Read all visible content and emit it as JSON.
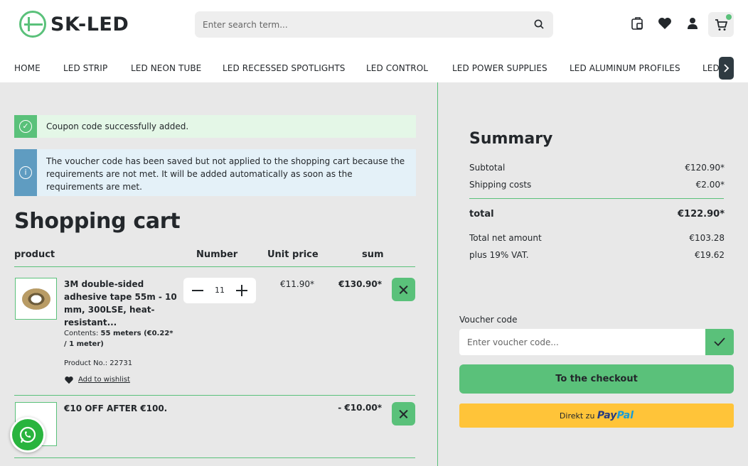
{
  "brand": {
    "name": "SK-LED"
  },
  "search": {
    "placeholder": "Enter search term..."
  },
  "header_icons": [
    "compare-icon",
    "heart-icon",
    "user-icon",
    "cart-icon"
  ],
  "nav": {
    "items": [
      "HOME",
      "LED STRIP",
      "LED NEON TUBE",
      "LED RECESSED SPOTLIGHTS",
      "LED CONTROL",
      "LED POWER SUPPLIES",
      "LED ALUMINUM PROFILES",
      "LED"
    ]
  },
  "alerts": {
    "success": "Coupon code successfully added.",
    "info": "The voucher code has been saved but not applied to the shopping cart because the requirements are not met. It will be added automatically as soon as the requirements are met."
  },
  "cart": {
    "title": "Shopping cart",
    "columns": {
      "product": "product",
      "number": "Number",
      "unit_price": "Unit price",
      "sum": "sum"
    },
    "items": [
      {
        "name": "3M double-sided adhesive tape 55m - 10 mm, 300LSE, heat-resistant...",
        "contents_label": "Contents:",
        "contents_value": "55 meters (€0.22* / 1 meter)",
        "product_no": "Product No.: 22731",
        "wishlist": "Add to wishlist",
        "quantity": "11",
        "unit_price": "€11.90*",
        "sum": "€130.90*"
      },
      {
        "name": "€10 OFF AFTER €100.",
        "sum": "- €10.00*"
      }
    ]
  },
  "summary": {
    "title": "Summary",
    "subtotal_label": "Subtotal",
    "subtotal": "€120.90*",
    "shipping_label": "Shipping costs",
    "shipping": "€2.00*",
    "total_label": "total",
    "total": "€122.90*",
    "net_label": "Total net amount",
    "net": "€103.28",
    "vat_label": "plus 19% VAT.",
    "vat": "€19.62"
  },
  "voucher": {
    "label": "Voucher code",
    "placeholder": "Enter voucher code..."
  },
  "checkout_label": "To the checkout",
  "paypal": {
    "prefix": "Direkt zu",
    "pay": "Pay",
    "pal": "Pal"
  },
  "colors": {
    "accent": "#5ac17a",
    "info": "#5f9cc1",
    "paypal": "#ffc439",
    "dark": "#23272b"
  }
}
